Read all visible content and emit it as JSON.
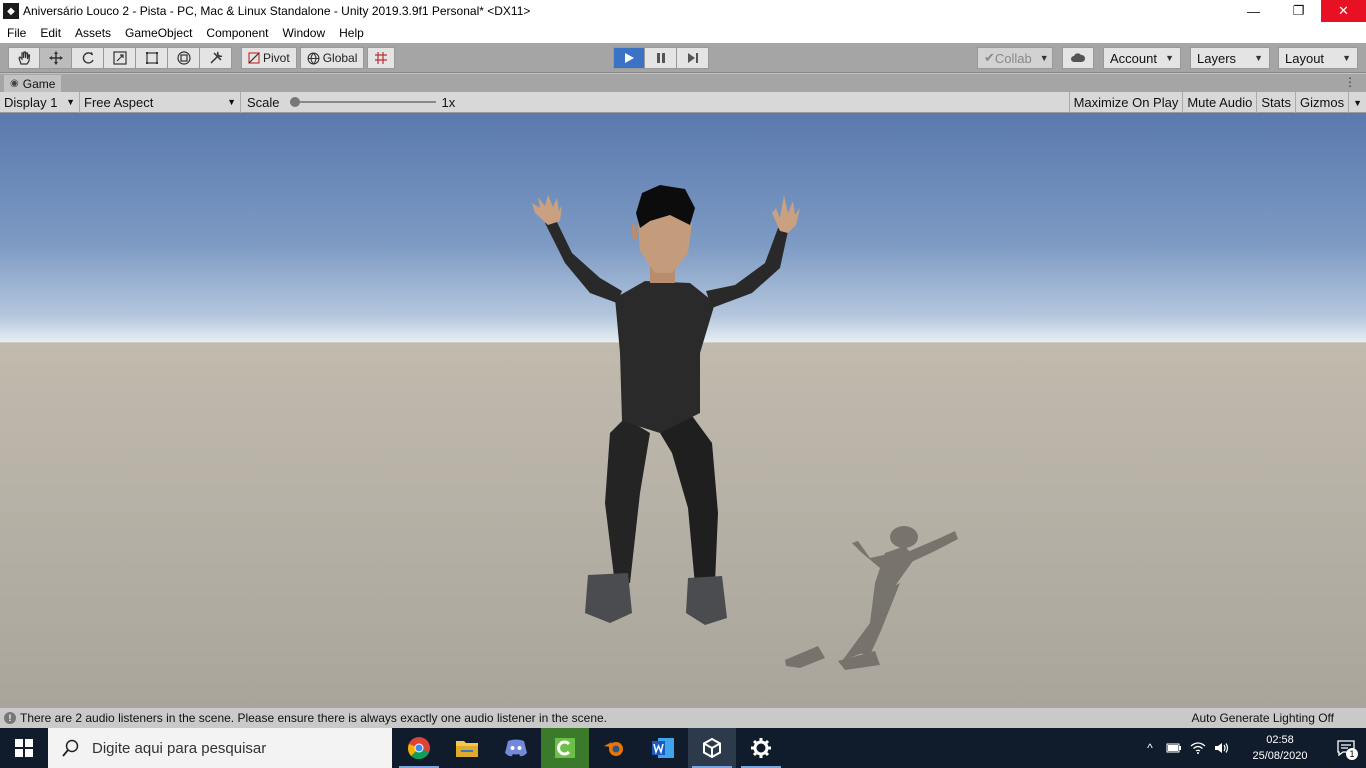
{
  "window": {
    "title": "Aniversário Louco 2 - Pista - PC, Mac & Linux Standalone - Unity 2019.3.9f1 Personal* <DX11>",
    "minimize": "—",
    "restore": "❐",
    "close": "✕"
  },
  "menu": [
    "File",
    "Edit",
    "Assets",
    "GameObject",
    "Component",
    "Window",
    "Help"
  ],
  "toolbar": {
    "pivot_label": "Pivot",
    "global_label": "Global",
    "collab_label": "Collab",
    "account_label": "Account",
    "layers_label": "Layers",
    "layout_label": "Layout"
  },
  "tab": {
    "label": "Game",
    "menu": "⋮"
  },
  "gamebar": {
    "display": "Display 1",
    "aspect": "Free Aspect",
    "scale_label": "Scale",
    "scale_value": "1x",
    "scale_level": 0,
    "maximize_on_play": "Maximize On Play",
    "mute_audio": "Mute Audio",
    "stats": "Stats",
    "gizmos": "Gizmos"
  },
  "status": {
    "icon": "!",
    "message": "There are 2 audio listeners in the scene. Please ensure there is always exactly one audio listener in the scene.",
    "right": "Auto Generate Lighting Off"
  },
  "taskbar": {
    "search_placeholder": "Digite aqui para pesquisar",
    "time": "02:58",
    "date": "25/08/2020",
    "notification_count": "1"
  },
  "colors": {
    "play_active": "#3a72c4",
    "close_button": "#e81123",
    "taskbar": "#101c2c"
  }
}
